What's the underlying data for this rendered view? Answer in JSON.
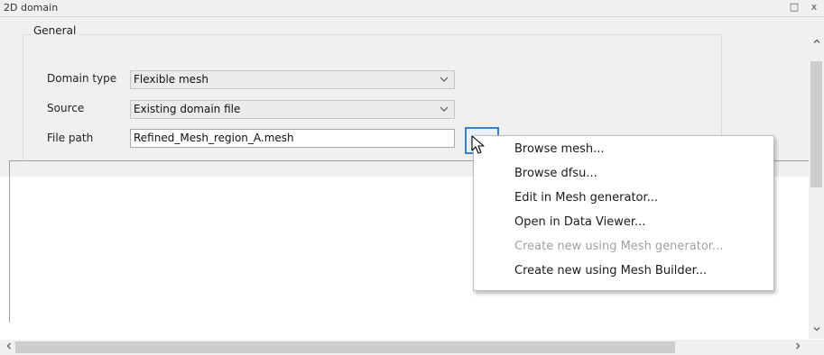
{
  "window": {
    "title": "2D domain",
    "restore_icon": "□",
    "close_icon": "x"
  },
  "general": {
    "legend": "General",
    "domain_type_label": "Domain type",
    "domain_type_value": "Flexible mesh",
    "source_label": "Source",
    "source_value": "Existing domain file",
    "file_path_label": "File path",
    "file_path_value": "Refined_Mesh_region_A.mesh"
  },
  "context_menu": {
    "items": [
      {
        "label": "Browse mesh...",
        "enabled": true
      },
      {
        "label": "Browse dfsu...",
        "enabled": true
      },
      {
        "label": "Edit in Mesh generator...",
        "enabled": true
      },
      {
        "label": "Open in Data Viewer...",
        "enabled": true
      },
      {
        "label": "Create new using Mesh generator...",
        "enabled": false
      },
      {
        "label": "Create new using Mesh Builder...",
        "enabled": true
      }
    ]
  },
  "icons": {
    "dropdown": "chevron-down-icon",
    "browse": "browse-button",
    "scroll_up": "scroll-up-icon",
    "scroll_down": "scroll-down-icon",
    "scroll_left": "scroll-left-icon",
    "scroll_right": "scroll-right-icon",
    "accent": "#3c7fce"
  }
}
